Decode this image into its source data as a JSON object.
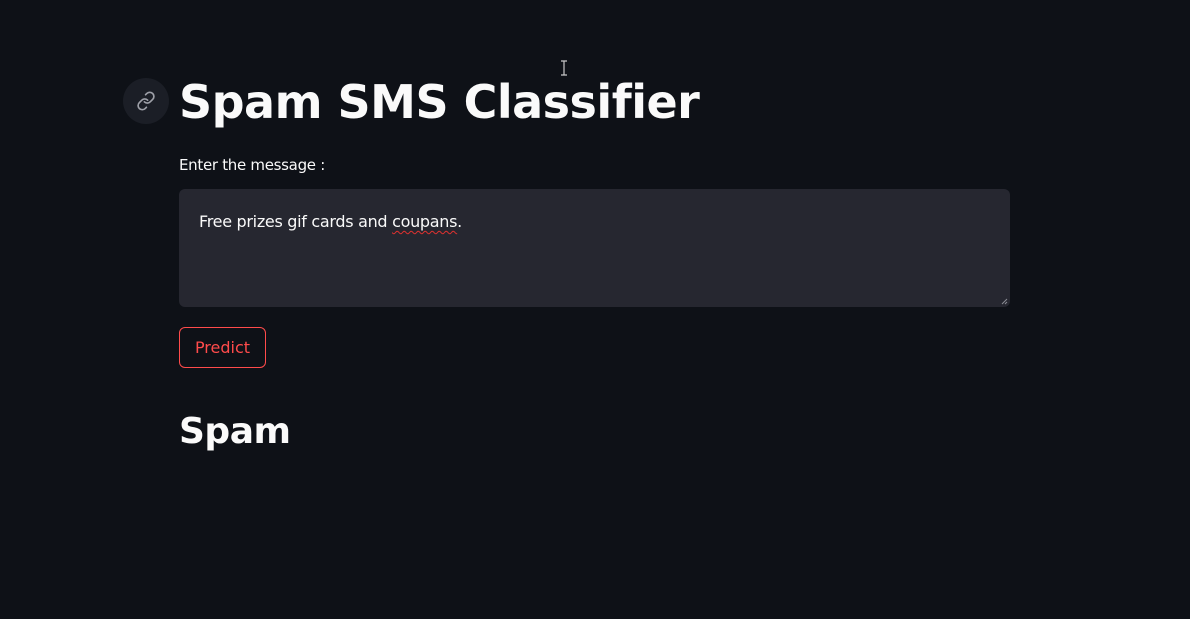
{
  "app": {
    "title": "Spam SMS Classifier"
  },
  "form": {
    "label": "Enter the message :",
    "message_parts": {
      "before": "Free prizes gif cards and ",
      "misspelled": "coupans",
      "after": "."
    },
    "predict_label": "Predict"
  },
  "result": {
    "prediction": "Spam"
  },
  "icons": {
    "anchor": "link-icon",
    "cursor": "text-cursor-icon",
    "resize": "resize-handle-icon"
  },
  "colors": {
    "background": "#0e1117",
    "input_background": "#262730",
    "text": "#fafafa",
    "accent": "#ff4b4b"
  }
}
